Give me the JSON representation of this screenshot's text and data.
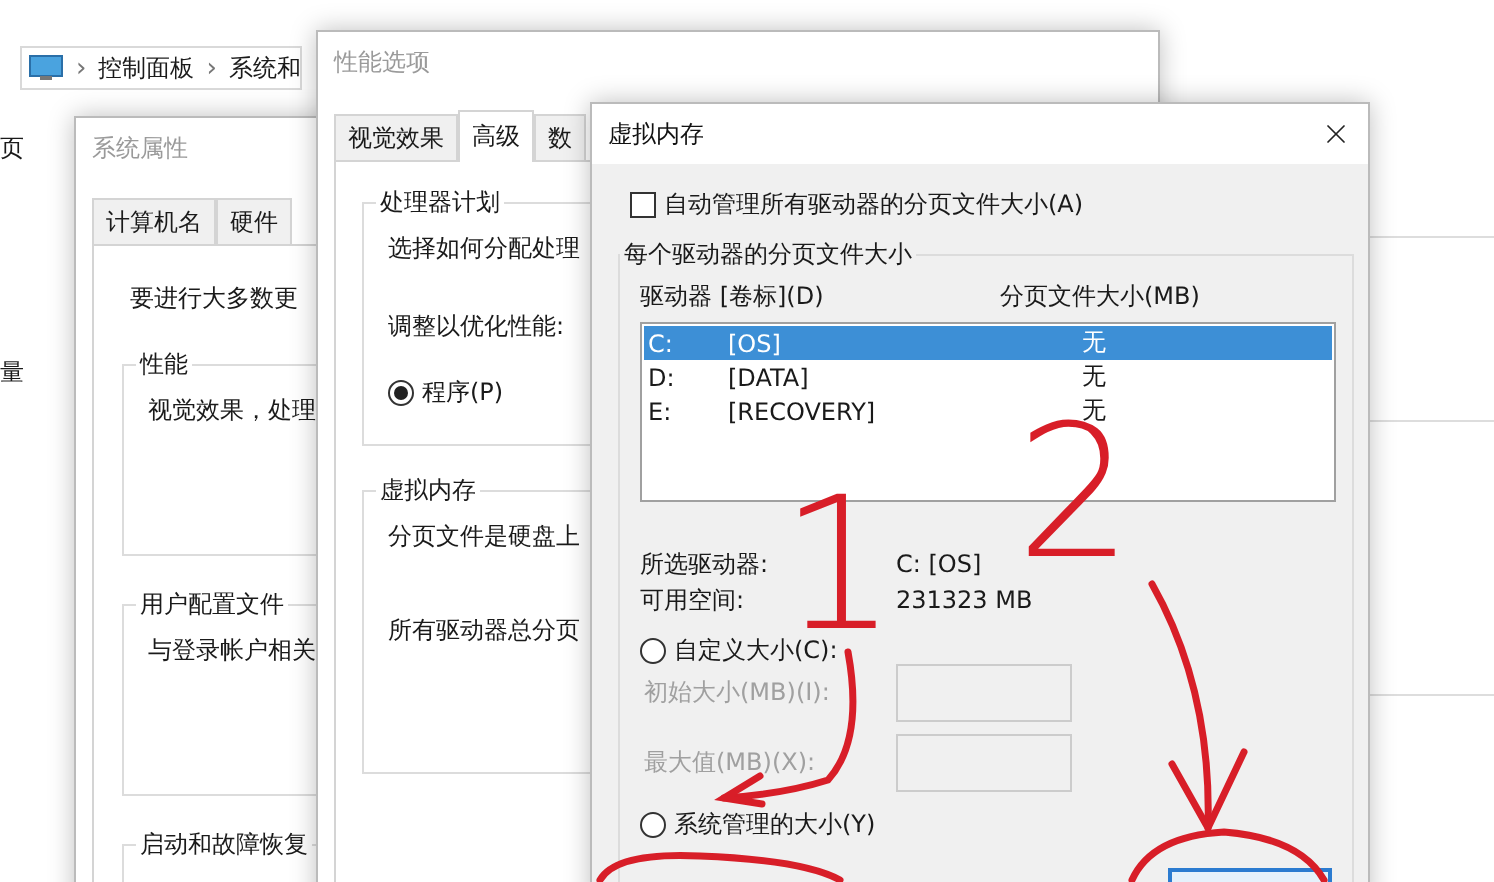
{
  "explorer": {
    "breadcrumb": [
      {
        "kind": "separator",
        "text": "›"
      },
      {
        "kind": "item",
        "text": "控制面板"
      },
      {
        "kind": "separator",
        "text": "›"
      },
      {
        "kind": "item",
        "text": "系统和"
      }
    ],
    "nav_fragments": [
      "页",
      "量"
    ]
  },
  "system_properties": {
    "title": "系统属性",
    "active": false,
    "tabs": [
      {
        "label": "计算机名",
        "selected": false
      },
      {
        "label": "硬件",
        "selected": false
      }
    ],
    "intro": "要进行大多数更",
    "groups": [
      {
        "title": "性能",
        "text": "视觉效果，处理"
      },
      {
        "title": "用户配置文件",
        "text": "与登录帐户相关"
      },
      {
        "title": "启动和故障恢复"
      }
    ]
  },
  "performance_options": {
    "title": "性能选项",
    "active": false,
    "tabs": [
      {
        "label": "视觉效果",
        "selected": false
      },
      {
        "label": "高级",
        "selected": true
      },
      {
        "label": "数",
        "selected": false
      }
    ],
    "processor_group": {
      "title": "处理器计划",
      "text": "选择如何分配处理",
      "prompt": "调整以优化性能:",
      "option": {
        "label": "程序(P)",
        "selected": true
      }
    },
    "memory_group": {
      "title": "虚拟内存",
      "text": "分页文件是硬盘上",
      "total": "所有驱动器总分页"
    }
  },
  "virtual_memory": {
    "title": "虚拟内存",
    "active": true,
    "auto_manage": {
      "label": "自动管理所有驱动器的分页文件大小(A)",
      "checked": false
    },
    "group_title": "每个驱动器的分页文件大小",
    "columns": [
      "驱动器 [卷标](D)",
      "分页文件大小(MB)"
    ],
    "drives": [
      {
        "drive": "C:",
        "label": "[OS]",
        "size": "无",
        "selected": true
      },
      {
        "drive": "D:",
        "label": "[DATA]",
        "size": "无",
        "selected": false
      },
      {
        "drive": "E:",
        "label": "[RECOVERY]",
        "size": "无",
        "selected": false
      }
    ],
    "selected_drive_label": "所选驱动器:",
    "selected_drive": "C:  [OS]",
    "free_space_label": "可用空间:",
    "free_space": "231323 MB",
    "size_options": [
      {
        "kind": "custom",
        "label": "自定义大小(C):",
        "selected": false
      },
      {
        "kind": "system",
        "label": "系统管理的大小(Y)",
        "selected": false
      }
    ],
    "fields": [
      {
        "label": "初始大小(MB)(I):",
        "disabled": true
      },
      {
        "label": "最大值(MB)(X):",
        "disabled": true
      }
    ]
  },
  "annotations": [
    {
      "kind": "number",
      "text": "1"
    },
    {
      "kind": "number",
      "text": "2"
    }
  ]
}
